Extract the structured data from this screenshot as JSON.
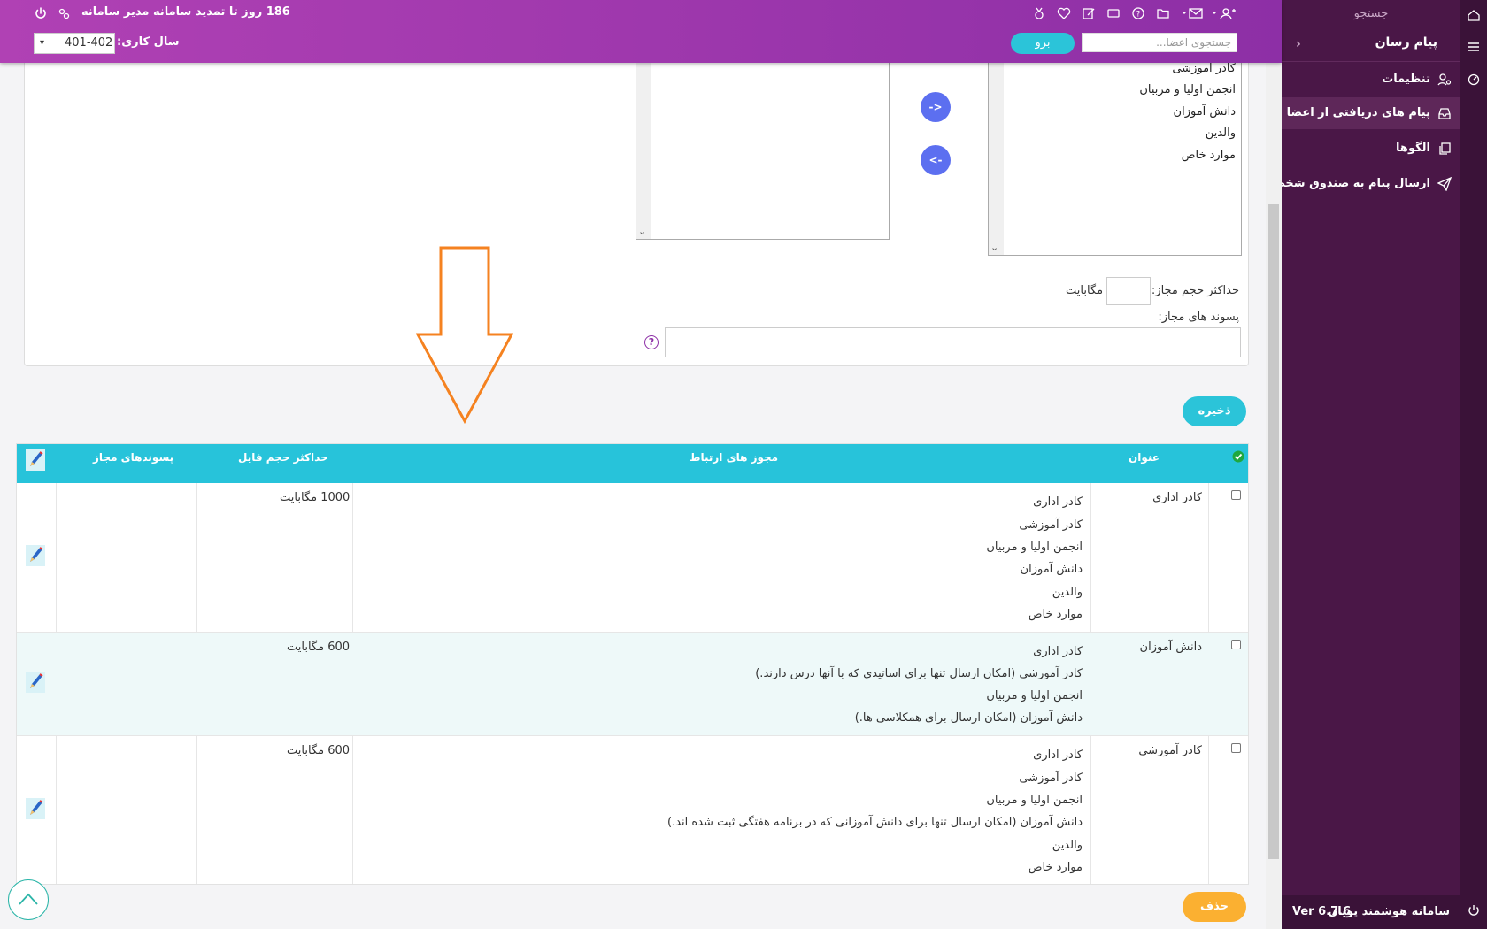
{
  "header": {
    "renewal_text": "186 روز تا تمدید سامانه مدیر سامانه",
    "year_label": "سال کاری:",
    "year_value": "401-402",
    "search_placeholder": "جستجوی اعضا...",
    "go_label": "برو"
  },
  "sidebar": {
    "search_label": "جستجو",
    "section_title": "پیام رسان",
    "items": [
      {
        "label": "تنظیمات",
        "icon": "user-gear-icon"
      },
      {
        "label": "پیام های دریافتی از اعضا",
        "icon": "inbox-icon"
      },
      {
        "label": "الگوها",
        "icon": "copy-icon"
      },
      {
        "label": "ارسال پیام به صندوق شخصی...",
        "icon": "send-icon"
      }
    ],
    "footer_name": "سامانه هوشمند پویان",
    "footer_version": "Ver 6.7.6"
  },
  "form": {
    "source_list": [
      "کادر آموزشی",
      "انجمن اولیا و مربیان",
      "دانش آموزان",
      "والدین",
      "موارد خاص"
    ],
    "move_right_label": "->",
    "move_left_label": "<-",
    "max_size_label": "حداکثر حجم مجاز:",
    "max_size_unit": "مگابایت",
    "extensions_label": "پسوند های مجاز:",
    "help_glyph": "?",
    "save_label": "ذخیره"
  },
  "table": {
    "headers": {
      "title": "عنوان",
      "permissions": "مجوز های ارتباط",
      "max_size": "حداکثر حجم فایل",
      "extensions": "پسوندهای مجاز"
    },
    "rows": [
      {
        "title": "کادر اداری",
        "permissions": [
          "کادر اداری",
          "کادر آموزشی",
          "انجمن اولیا و مربیان",
          "دانش آموزان",
          "والدین",
          "موارد خاص"
        ],
        "max_size": "1000 مگابایت",
        "extensions": ""
      },
      {
        "title": "دانش آموزان",
        "permissions": [
          "کادر اداری",
          "کادر آموزشی (امکان ارسال تنها برای اساتیدی که با آنها درس دارند.)",
          "انجمن اولیا و مربیان",
          "دانش آموزان (امکان ارسال برای همکلاسی ها.)"
        ],
        "max_size": "600 مگابایت",
        "extensions": ""
      },
      {
        "title": "کادر آموزشی",
        "permissions": [
          "کادر اداری",
          "کادر آموزشی",
          "انجمن اولیا و مربیان",
          "دانش آموزان (امکان ارسال تنها برای دانش آموزانی که در برنامه هفتگی ثبت شده اند.)",
          "والدین",
          "موارد خاص"
        ],
        "max_size": "600 مگابایت",
        "extensions": ""
      }
    ],
    "delete_label": "حذف"
  },
  "colors": {
    "header_purple": "#9b37ad",
    "sidebar_bg": "#4a1747",
    "table_header": "#27c3da",
    "save_button": "#2bc4d9",
    "delete_button": "#fbb031",
    "arrow_orange": "#f58220"
  }
}
